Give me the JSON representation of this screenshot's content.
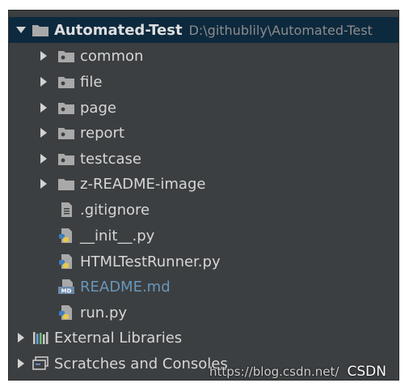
{
  "project": {
    "name": "Automated-Test",
    "path": "D:\\githublily\\Automated-Test"
  },
  "items": [
    {
      "label": "common",
      "type": "folder"
    },
    {
      "label": "file",
      "type": "folder"
    },
    {
      "label": "page",
      "type": "folder"
    },
    {
      "label": "report",
      "type": "folder"
    },
    {
      "label": "testcase",
      "type": "folder"
    },
    {
      "label": "z-README-image",
      "type": "folder"
    },
    {
      "label": ".gitignore",
      "type": "text-file"
    },
    {
      "label": "__init__.py",
      "type": "python-file"
    },
    {
      "label": "HTMLTestRunner.py",
      "type": "python-file"
    },
    {
      "label": "README.md",
      "type": "markdown-file"
    },
    {
      "label": "run.py",
      "type": "python-file"
    }
  ],
  "external_libraries": {
    "label": "External Libraries"
  },
  "scratches": {
    "label": "Scratches and Consoles"
  },
  "watermark": {
    "url": "https://blog.csdn.net/",
    "brand": "CSDN @静姐说测试"
  },
  "colors": {
    "background": "#3c3f41",
    "selection": "#0d293e",
    "text": "#d6d6d6",
    "markdown_text": "#6897bb"
  }
}
